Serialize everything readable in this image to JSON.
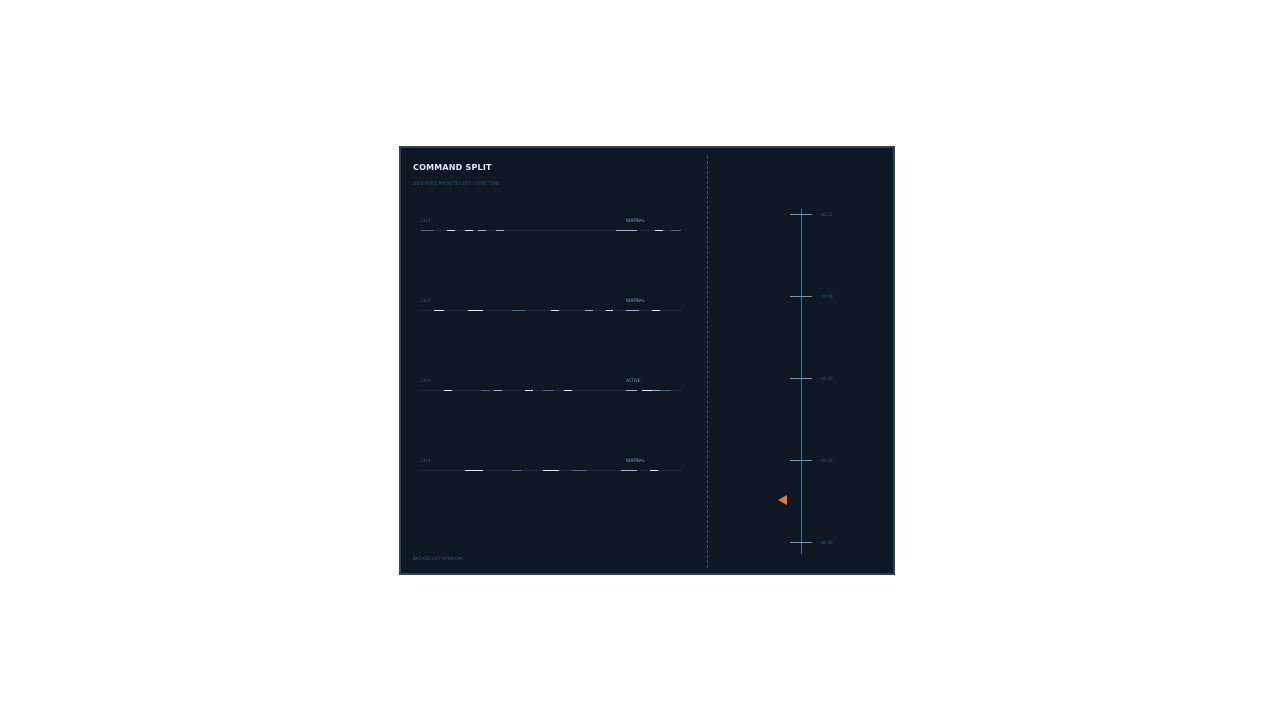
{
  "header": {
    "title": "COMMAND SPLIT",
    "subtitle": "OBSERVED PACKETS LEFT / SYNC TIME"
  },
  "footer": {
    "text": "BROADCAST WINDOW"
  },
  "channels": [
    {
      "label": "CH 1",
      "status": "NOMINAL",
      "segments": [
        {
          "start": 0.0,
          "end": 0.05,
          "tone": "dim"
        },
        {
          "start": 0.1,
          "end": 0.13,
          "tone": "bright"
        },
        {
          "start": 0.17,
          "end": 0.2,
          "tone": "bright"
        },
        {
          "start": 0.22,
          "end": 0.25,
          "tone": "normal"
        },
        {
          "start": 0.29,
          "end": 0.32,
          "tone": "normal"
        },
        {
          "start": 0.75,
          "end": 0.83,
          "tone": "normal"
        },
        {
          "start": 0.9,
          "end": 0.93,
          "tone": "bright"
        },
        {
          "start": 0.96,
          "end": 1.0,
          "tone": "dim"
        }
      ]
    },
    {
      "label": "CH 2",
      "status": "NOMINAL",
      "segments": [
        {
          "start": 0.05,
          "end": 0.09,
          "tone": "bright"
        },
        {
          "start": 0.18,
          "end": 0.24,
          "tone": "bright"
        },
        {
          "start": 0.35,
          "end": 0.4,
          "tone": "dim"
        },
        {
          "start": 0.5,
          "end": 0.53,
          "tone": "bright"
        },
        {
          "start": 0.63,
          "end": 0.66,
          "tone": "normal"
        },
        {
          "start": 0.71,
          "end": 0.74,
          "tone": "bright"
        },
        {
          "start": 0.79,
          "end": 0.84,
          "tone": "normal"
        },
        {
          "start": 0.89,
          "end": 0.92,
          "tone": "bright"
        }
      ]
    },
    {
      "label": "CH 3",
      "status": "ACTIVE",
      "segments": [
        {
          "start": 0.09,
          "end": 0.12,
          "tone": "bright"
        },
        {
          "start": 0.23,
          "end": 0.26,
          "tone": "dim"
        },
        {
          "start": 0.28,
          "end": 0.31,
          "tone": "normal"
        },
        {
          "start": 0.4,
          "end": 0.43,
          "tone": "bright"
        },
        {
          "start": 0.47,
          "end": 0.51,
          "tone": "dim"
        },
        {
          "start": 0.55,
          "end": 0.58,
          "tone": "bright"
        },
        {
          "start": 0.79,
          "end": 0.83,
          "tone": "normal"
        },
        {
          "start": 0.85,
          "end": 0.89,
          "tone": "bright"
        },
        {
          "start": 0.89,
          "end": 0.92,
          "tone": "normal"
        },
        {
          "start": 0.92,
          "end": 0.96,
          "tone": "dim"
        }
      ]
    },
    {
      "label": "CH 4",
      "status": "NOMINAL",
      "segments": [
        {
          "start": 0.17,
          "end": 0.24,
          "tone": "bright"
        },
        {
          "start": 0.35,
          "end": 0.39,
          "tone": "dim"
        },
        {
          "start": 0.47,
          "end": 0.53,
          "tone": "bright"
        },
        {
          "start": 0.58,
          "end": 0.64,
          "tone": "dim"
        },
        {
          "start": 0.77,
          "end": 0.83,
          "tone": "normal"
        },
        {
          "start": 0.88,
          "end": 0.91,
          "tone": "bright"
        }
      ]
    }
  ],
  "timeline": {
    "ticks": [
      "00:12",
      "00:09",
      "00:06",
      "00:03",
      "00:00"
    ],
    "marker_color": "#e8773a"
  },
  "colors": {
    "background": "#0e1722",
    "border": "#2b4156",
    "accent": "#e8773a",
    "axis": "#4a6f96"
  }
}
